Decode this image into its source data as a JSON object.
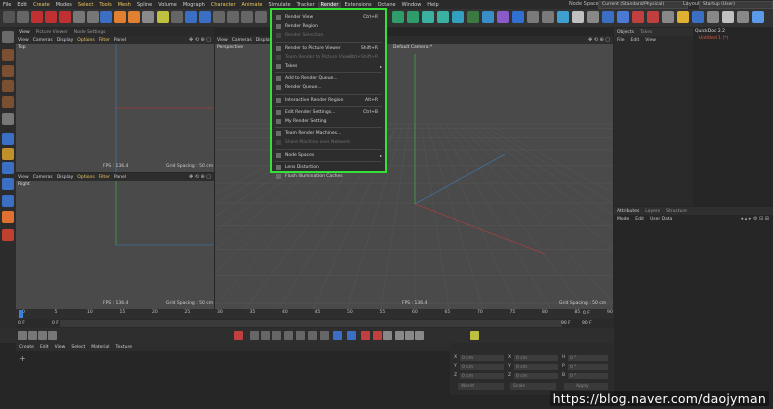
{
  "menubar": {
    "items": [
      "File",
      "Edit",
      "Create",
      "Modes",
      "Select",
      "Tools",
      "Mesh",
      "Spline",
      "Volume",
      "Mograph",
      "Character",
      "Animate",
      "Simulate",
      "Tracker",
      "Render",
      "Extensions",
      "Octane",
      "Window",
      "Help"
    ],
    "node_space_label": "Node Space:",
    "node_space_value": "Current (Standard/Physical)",
    "layout_label": "Layout:",
    "layout_value": "Startup (User)"
  },
  "viewport_tl": {
    "tabs": [
      "View",
      "Picture Viewer",
      "Node Settings"
    ],
    "menus": [
      "View",
      "Cameras",
      "Display",
      "Options",
      "Filter",
      "Panel"
    ],
    "title": "Top",
    "fps": "FPS : 136.4",
    "grid": "Grid Spacing : 50 cm"
  },
  "viewport_bl": {
    "menus": [
      "View",
      "Cameras",
      "Display",
      "Options",
      "Filter",
      "Panel"
    ],
    "title": "Right",
    "fps": "FPS : 136.4",
    "grid": "Grid Spacing : 50 cm"
  },
  "viewport_main": {
    "menus": [
      "View",
      "Cameras",
      "Display"
    ],
    "title": "Perspective",
    "camera": "Default Camera:*",
    "fps": "FPS : 136.4",
    "grid": "Grid Spacing : 50 cm"
  },
  "render_menu": {
    "items": [
      {
        "label": "Render View",
        "shortcut": "Ctrl+R",
        "disabled": false
      },
      {
        "label": "Render Region",
        "shortcut": "",
        "disabled": false
      },
      {
        "label": "Render Selection",
        "shortcut": "",
        "disabled": true
      },
      {
        "sep": true
      },
      {
        "label": "Render to Picture Viewer",
        "shortcut": "Shift+R",
        "disabled": false
      },
      {
        "label": "Team Render to Picture Viewer...",
        "shortcut": "Ctrl+Shift+R",
        "disabled": true
      },
      {
        "label": "Takes",
        "shortcut": "",
        "disabled": false,
        "submenu": true
      },
      {
        "sep": true
      },
      {
        "label": "Add to Render Queue...",
        "shortcut": "",
        "disabled": false
      },
      {
        "label": "Render Queue...",
        "shortcut": "",
        "disabled": false
      },
      {
        "sep": true
      },
      {
        "label": "Interactive Render Region",
        "shortcut": "Alt+R",
        "disabled": false
      },
      {
        "sep": true
      },
      {
        "label": "Edit Render Settings...",
        "shortcut": "Ctrl+B",
        "disabled": false
      },
      {
        "label": "My Render Setting",
        "shortcut": "",
        "disabled": false
      },
      {
        "sep": true
      },
      {
        "label": "Team Render Machines...",
        "shortcut": "",
        "disabled": false
      },
      {
        "label": "Share Machine over Network",
        "shortcut": "",
        "disabled": true
      },
      {
        "sep": true
      },
      {
        "label": "Node Spaces",
        "shortcut": "",
        "disabled": false,
        "submenu": true
      },
      {
        "sep": true
      },
      {
        "label": "Lens Distortion",
        "shortcut": "",
        "disabled": false
      },
      {
        "label": "Flush Illumination Caches",
        "shortcut": "",
        "disabled": false
      }
    ]
  },
  "objects_panel": {
    "tabs": [
      "Objects",
      "Takes"
    ],
    "menus": [
      "File",
      "Edit",
      "View"
    ],
    "tree": [
      "QuickDoc 2.2",
      "Untitled 1 (*)"
    ]
  },
  "attributes": {
    "tabs": [
      "Attributes",
      "Layers",
      "Structure"
    ],
    "menus": [
      "Mode",
      "Edit",
      "User Data"
    ]
  },
  "timeline": {
    "ticks": [
      "0",
      "5",
      "10",
      "15",
      "20",
      "25",
      "30",
      "35",
      "40",
      "45",
      "50",
      "55",
      "60",
      "65",
      "70",
      "75",
      "80",
      "85",
      "90"
    ],
    "frame_left": "0 F",
    "frame_left2": "0 F",
    "frame_right": "90 F",
    "frame_right2": "90 F",
    "frame_current": "0 F"
  },
  "material_bar": {
    "menus": [
      "Create",
      "Edit",
      "View",
      "Select",
      "Material",
      "Texture"
    ]
  },
  "coords": {
    "rows": [
      {
        "a": "X",
        "av": "0 cm",
        "b": "X",
        "bv": "0 cm",
        "c": "H",
        "cv": "0 °"
      },
      {
        "a": "Y",
        "av": "0 cm",
        "b": "Y",
        "bv": "0 cm",
        "c": "P",
        "cv": "0 °"
      },
      {
        "a": "Z",
        "av": "0 cm",
        "b": "Z",
        "bv": "0 cm",
        "c": "B",
        "cv": "0 °"
      }
    ],
    "mode1": "World",
    "mode2": "Scale",
    "apply": "Apply"
  },
  "watermark": "https://blog.naver.com/daojyman"
}
